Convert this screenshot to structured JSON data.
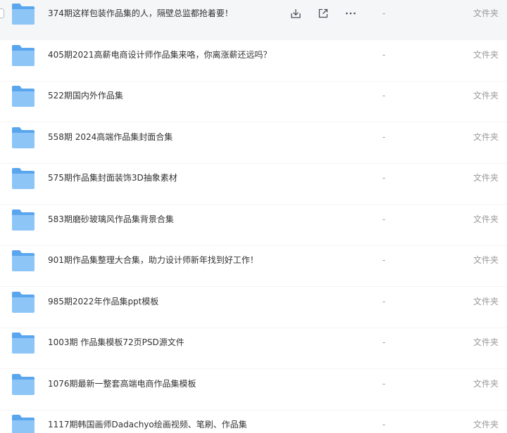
{
  "files": [
    {
      "name": "374期这样包装作品集的人，隔壁总监都抢着要！",
      "size": "-",
      "type": "文件夹"
    },
    {
      "name": "405期2021高薪电商设计师作品集来咯，你离涨薪还远吗？",
      "size": "-",
      "type": "文件夹"
    },
    {
      "name": "522期国内外作品集",
      "size": "-",
      "type": "文件夹"
    },
    {
      "name": "558期 2024高端作品集封面合集",
      "size": "-",
      "type": "文件夹"
    },
    {
      "name": "575期作品集封面装饰3D抽象素材",
      "size": "-",
      "type": "文件夹"
    },
    {
      "name": "583期磨砂玻璃风作品集背景合集",
      "size": "-",
      "type": "文件夹"
    },
    {
      "name": "901期作品集整理大合集，助力设计师新年找到好工作！",
      "size": "-",
      "type": "文件夹"
    },
    {
      "name": "985期2022年作品集ppt模板",
      "size": "-",
      "type": "文件夹"
    },
    {
      "name": "1003期 作品集模板72页PSD源文件",
      "size": "-",
      "type": "文件夹"
    },
    {
      "name": "1076期最新一整套高端电商作品集模板",
      "size": "-",
      "type": "文件夹"
    },
    {
      "name": "1117期韩国画师Dadachyo绘画视频、笔刷、作品集",
      "size": "-",
      "type": "文件夹"
    }
  ],
  "row_actions": {
    "download_icon": "download-icon",
    "share_icon": "share-icon",
    "more_icon": "more-icon"
  },
  "colors": {
    "folder_body": "#8ec5f7",
    "folder_back": "#5aa6ee",
    "text": "#333333",
    "muted": "#9a9a9a",
    "hover_row": "#f5f6f8"
  }
}
